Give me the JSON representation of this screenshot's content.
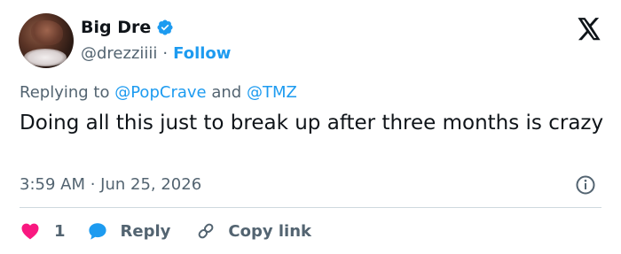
{
  "author": {
    "display_name": "Big Dre",
    "handle": "@drezziiii",
    "separator": "·",
    "follow_label": "Follow"
  },
  "reply_context": {
    "prefix": "Replying to",
    "mention_1": "@PopCrave",
    "conjunction": "and",
    "mention_2": "@TMZ"
  },
  "tweet": {
    "text": "Doing all this just to break up after three months is crazy",
    "timestamp": "3:59 AM · Jun 25, 2026"
  },
  "actions": {
    "like_count": "1",
    "reply_label": "Reply",
    "copy_link_label": "Copy link"
  },
  "colors": {
    "accent": "#1d9bf0",
    "like": "#f91880",
    "secondary_text": "#536471",
    "primary_text": "#0f1419"
  },
  "icons": [
    "verified-badge-icon",
    "x-logo-icon",
    "info-icon",
    "heart-icon",
    "reply-bubble-icon",
    "link-icon"
  ]
}
